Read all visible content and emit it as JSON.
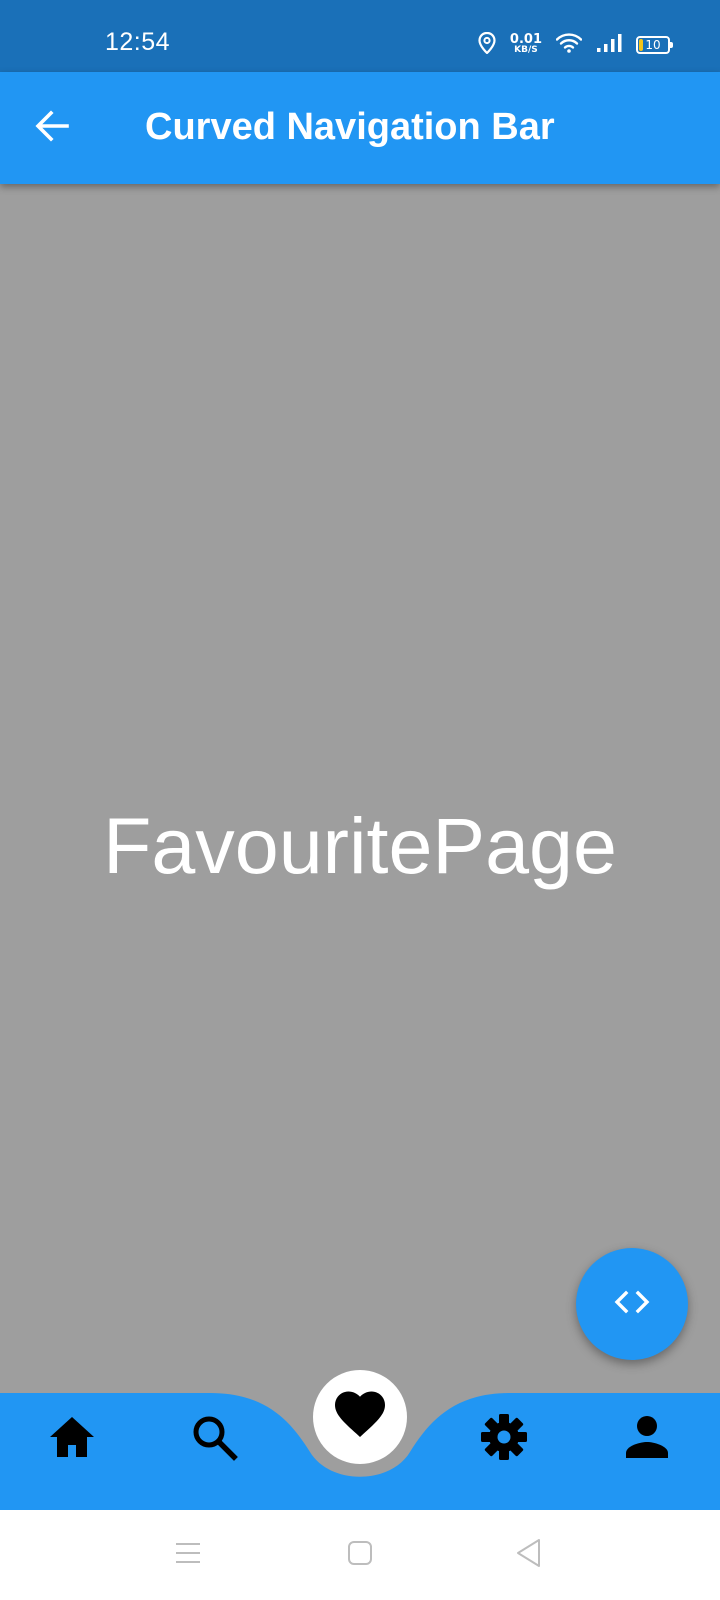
{
  "status_bar": {
    "time": "12:54",
    "net_speed_value": "0.01",
    "net_speed_unit": "KB/S",
    "battery_level": "10",
    "icons": [
      "location-icon",
      "wifi-icon",
      "signal-icon",
      "battery-icon"
    ]
  },
  "app_bar": {
    "title": "Curved Navigation Bar",
    "back_icon": "arrow-back-icon"
  },
  "page": {
    "label": "FavouritePage"
  },
  "fab": {
    "icon": "code-icon"
  },
  "bottom_nav": {
    "items": [
      {
        "icon": "home-icon",
        "selected": false
      },
      {
        "icon": "search-icon",
        "selected": false
      },
      {
        "icon": "heart-icon",
        "selected": true
      },
      {
        "icon": "settings-icon",
        "selected": false
      },
      {
        "icon": "person-icon",
        "selected": false
      }
    ]
  },
  "system_nav": {
    "items": [
      "menu-icon",
      "home-square-icon",
      "back-triangle-icon"
    ]
  },
  "colors": {
    "status_bar": "#1A70B8",
    "primary": "#2196F3",
    "background": "#9E9E9E",
    "icon": "#000000",
    "text_light": "#FFFFFF"
  }
}
